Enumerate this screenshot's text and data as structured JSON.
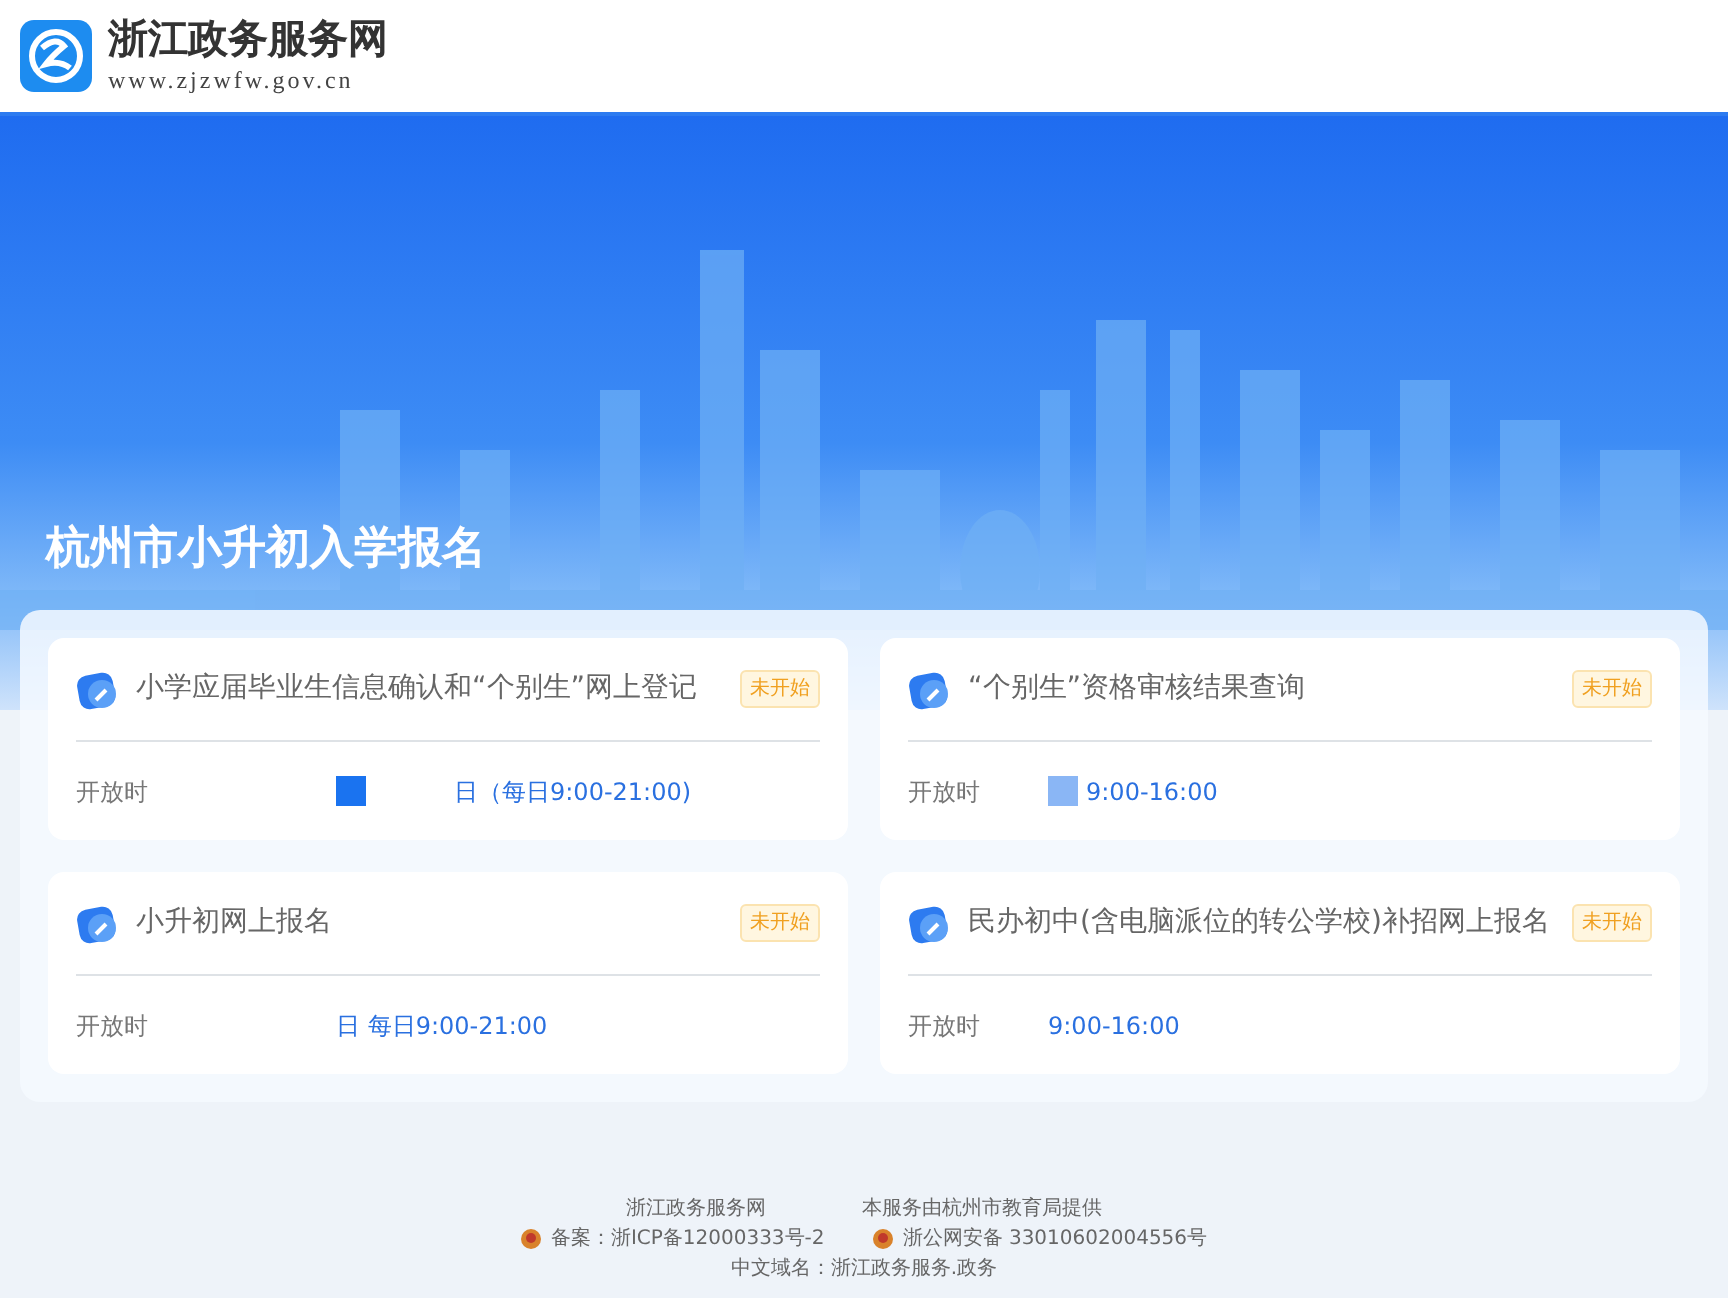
{
  "header": {
    "site_name": "浙江政务服务网",
    "site_url": "www.zjzwfw.gov.cn"
  },
  "banner": {
    "title": "杭州市小升初入学报名"
  },
  "services": [
    {
      "title": "小学应届毕业生信息确认和“个别生”网上登记",
      "status": "未开始",
      "time_label": "开放时",
      "color": "#1a73f0",
      "time": "日（每日9:00-21:00)"
    },
    {
      "title": "“个别生”资格审核结果查询",
      "status": "未开始",
      "time_label": "开放时",
      "color": "#8ab6f5",
      "time": "9:00-16:00"
    },
    {
      "title": "小升初网上报名",
      "status": "未开始",
      "time_label": "开放时",
      "time": "日 每日9:00-21:00"
    },
    {
      "title": "民办初中(含电脑派位的转公学校)补招网上报名",
      "status": "未开始",
      "time_label": "开放时",
      "time": "9:00-16:00"
    }
  ],
  "footer": {
    "line1": [
      "浙江政务服务网",
      "本服务由杭州市教育局提供"
    ],
    "icp": "备案：浙ICP备12000333号-2",
    "police": "浙公网安备 33010602004556号",
    "domain": "中文域名：浙江政务服务.政务"
  }
}
